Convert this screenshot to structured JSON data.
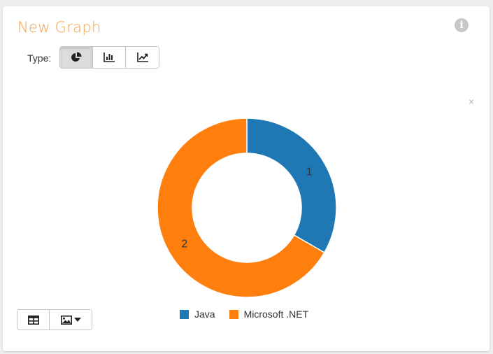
{
  "card": {
    "title": "New Graph",
    "info_glyph": "i",
    "type_label": "Type:",
    "type_buttons": [
      {
        "icon": "pie-chart-icon",
        "active": true
      },
      {
        "icon": "bar-chart-icon",
        "active": false
      },
      {
        "icon": "line-chart-icon",
        "active": false
      }
    ],
    "close_glyph": "×",
    "bottom_buttons": [
      {
        "icon": "table-icon"
      },
      {
        "icon": "image-icon",
        "caret": "caret-down-icon"
      }
    ]
  },
  "colors": {
    "title": "#f0a04b",
    "java": "#1f77b4",
    "dotnet": "#ff7f0e"
  },
  "chart_data": {
    "type": "pie",
    "variant": "donut",
    "categories": [
      "Java",
      "Microsoft .NET"
    ],
    "values": [
      1,
      2
    ],
    "data_labels": [
      "1",
      "2"
    ],
    "colors": [
      "#1f77b4",
      "#ff7f0e"
    ],
    "legend_position": "bottom"
  }
}
